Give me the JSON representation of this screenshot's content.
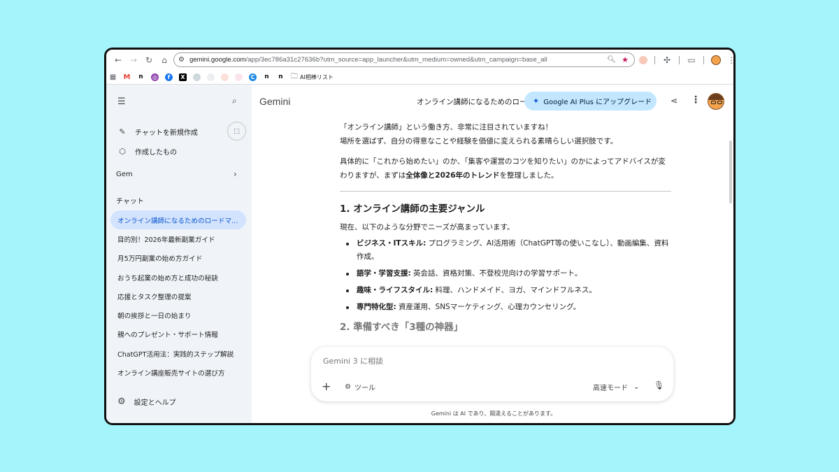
{
  "browser": {
    "url_domain": "gemini.google.com",
    "url_rest": "/app/3ec786a31c27636b?utm_source=app_launcher&utm_medium=owned&utm_campaign=base_all",
    "bookmark_folder": "AI相棒リスト"
  },
  "sidebar": {
    "new_chat": "チャットを新規作成",
    "my_stuff": "作成したもの",
    "gem": "Gem",
    "chat_header": "チャット",
    "chats": [
      "オンライン講師になるためのロードマ...",
      "目的別！2026年最新副業ガイド",
      "月5万円副業の始め方ガイド",
      "おうち起業の始め方と成功の秘訣",
      "応援とタスク整理の提案",
      "朝の挨拶と一日の始まり",
      "親へのプレゼント・サポート情報",
      "ChatGPT活用法：実践的ステップ解説",
      "オンライン講座販売サイトの選び方"
    ],
    "settings": "設定とヘルプ"
  },
  "header": {
    "brand": "Gemini",
    "conversation_title": "オンライン講師になるためのロードマップ",
    "upgrade_label": "Google AI Plus にアップグレード"
  },
  "response": {
    "p1_line1": "「オンライン講師」という働き方、非常に注目されていますね！",
    "p1_line2": "場所を選ばず、自分の得意なことや経験を価値に変えられる素晴らしい選択肢です。",
    "p2_a": "具体的に「これから始めたい」のか、「集客や運営のコツを知りたい」のかによってアドバイスが変わりますが、まずは",
    "p2_bold": "全体像と2026年のトレンド",
    "p2_b": "を整理しました。",
    "section1_title": "1. オンライン講師の主要ジャンル",
    "section1_intro": "現在、以下のような分野でニーズが高まっています。",
    "genres": [
      {
        "label": "ビジネス・ITスキル:",
        "text": " プログラミング、AI活用術（ChatGPT等の使いこなし）、動画編集、資料作成。"
      },
      {
        "label": "語学・学習支援:",
        "text": " 英会話、資格対策、不登校児向けの学習サポート。"
      },
      {
        "label": "趣味・ライフスタイル:",
        "text": " 料理、ハンドメイド、ヨガ、マインドフルネス。"
      },
      {
        "label": "専門特化型:",
        "text": " 資産運用、SNSマーケティング、心理カウンセリング。"
      }
    ],
    "section2_title": "2. 準備すべき「3種の神器」"
  },
  "composer": {
    "placeholder": "Gemini 3 に相談",
    "tools_label": "ツール",
    "mode_label": "高速モード"
  },
  "disclaimer": "Gemini は AI であり、間違えることがあります。",
  "colors": {
    "background": "#a3f5fb",
    "sidebar": "#f0f4f9",
    "active_chat": "#d3e3fd",
    "upgrade_button": "#c2e7ff"
  }
}
